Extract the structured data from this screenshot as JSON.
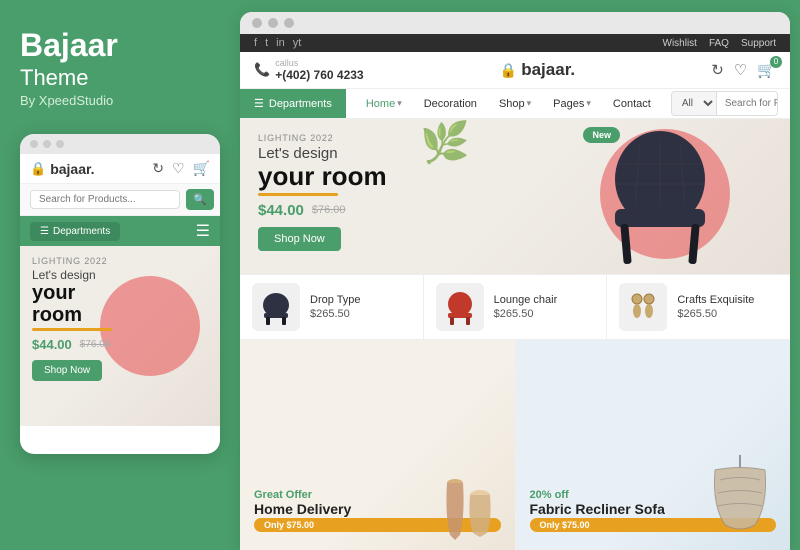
{
  "left": {
    "brand": "Bajaar",
    "theme_label": "Theme",
    "by": "By XpeedStudio",
    "mobile": {
      "logo": "bajaar.",
      "search_placeholder": "Search for Products...",
      "dept_btn": "Departments",
      "banner_tag": "LIGHTING 2022",
      "banner_line1": "Let's design",
      "banner_line2": "your",
      "banner_line3": "room",
      "price": "$44.00",
      "old_price": "$76.00",
      "shop_btn": "Shop Now"
    }
  },
  "right": {
    "title_bar": "···",
    "top_bar": {
      "social": [
        "f",
        "t",
        "in",
        "yt"
      ],
      "links": [
        "Wishlist",
        "FAQ",
        "Support"
      ]
    },
    "header": {
      "call_label": "callus",
      "phone": "+(402) 760 4233",
      "logo": "bajaar.",
      "icon_refresh": "↻",
      "icon_heart": "♡",
      "icon_cart": "🛒",
      "cart_count": "0"
    },
    "nav": {
      "dept_btn": "Departments",
      "links": [
        "Home",
        "Decoration",
        "Shop",
        "Pages",
        "Contact"
      ],
      "active": "Home",
      "search_placeholder": "Search for Products...",
      "search_all": "All"
    },
    "hero": {
      "tag": "LIGHTING 2022",
      "line1": "Let's design",
      "line2": "your room",
      "price": "$44.00",
      "old_price": "$76.00",
      "shop_btn": "Shop Now",
      "new_badge": "New"
    },
    "products": [
      {
        "name": "Drop Type",
        "price": "$265.50"
      },
      {
        "name": "Lounge chair",
        "price": "$265.50"
      },
      {
        "name": "Crafts Exquisite",
        "price": "$265.50"
      }
    ],
    "bottom_cards": [
      {
        "badge": "Only $75.00",
        "title_sm": "Great Offer",
        "title": "Home Delivery"
      },
      {
        "badge": "Only $75.00",
        "title_sm": "20% off",
        "title": "Fabric Recliner Sofa"
      }
    ]
  }
}
